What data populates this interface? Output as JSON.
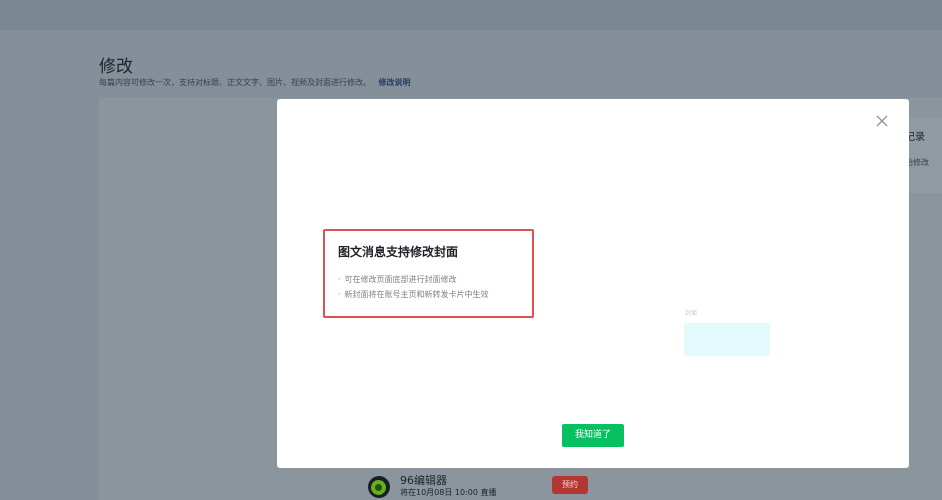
{
  "page": {
    "title": "修改",
    "description": "每篇内容可修改一次，支持对标题、正文文字、图片、视频及封面进行修改。",
    "description_link": "修改说明"
  },
  "right_panel": {
    "title_fragment": "记录",
    "subtitle_fragment": "始修改"
  },
  "bottom_item": {
    "name": "96编辑器",
    "time_text": "将在10月08日 10:00 直播",
    "reserve_label": "预约"
  },
  "modal": {
    "notice_title": "图文消息支持修改封面",
    "notice_lines": [
      "可在修改页面底部进行封面修改",
      "新封面将在账号主页和新转发卡片中生效"
    ],
    "cover_label": "封面",
    "confirm_label": "我知道了"
  },
  "colors": {
    "confirm_button": "#07c160",
    "highlight_border": "#e05050",
    "reserve_button": "#b43630"
  },
  "icons": {
    "close": "close-icon",
    "avatar": "snail-avatar-icon"
  }
}
